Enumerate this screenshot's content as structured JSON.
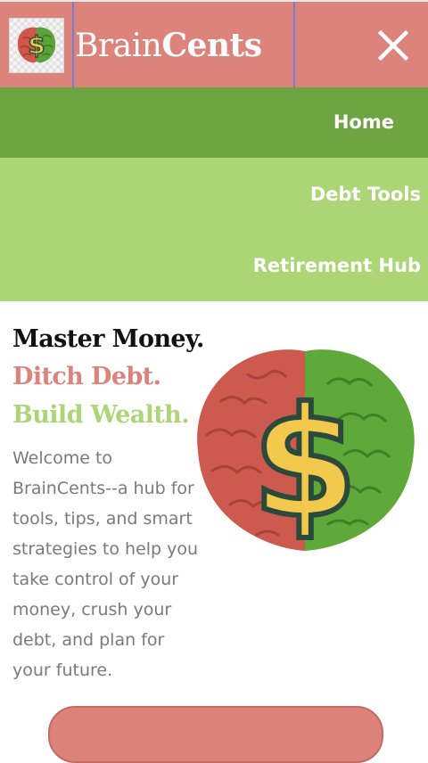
{
  "header": {
    "brand_part1": "Brain",
    "brand_part2": "Cents",
    "logo_icon": "brain-dollar-logo",
    "close_icon": "close-icon",
    "bg_color": "#dc837c"
  },
  "nav": {
    "items": [
      {
        "label": "Home",
        "active": true
      },
      {
        "label": "Debt Tools",
        "active": false
      },
      {
        "label": "Retirement Hub",
        "active": false
      }
    ],
    "active_color": "#6fa442",
    "menu_color": "#acd676"
  },
  "hero": {
    "title_line1": "Master Money.",
    "title_line2": "Ditch Debt.",
    "title_line3": "Build Wealth.",
    "intro": "Welcome to BrainCents--a hub for tools, tips, and smart strategies to help you take control of your money, crush your debt, and plan for your future.",
    "image_icon": "brain-dollar-illustration"
  },
  "colors": {
    "accent_red": "#dc837c",
    "accent_green": "#acd676",
    "text_gray": "#7a7a7a"
  }
}
